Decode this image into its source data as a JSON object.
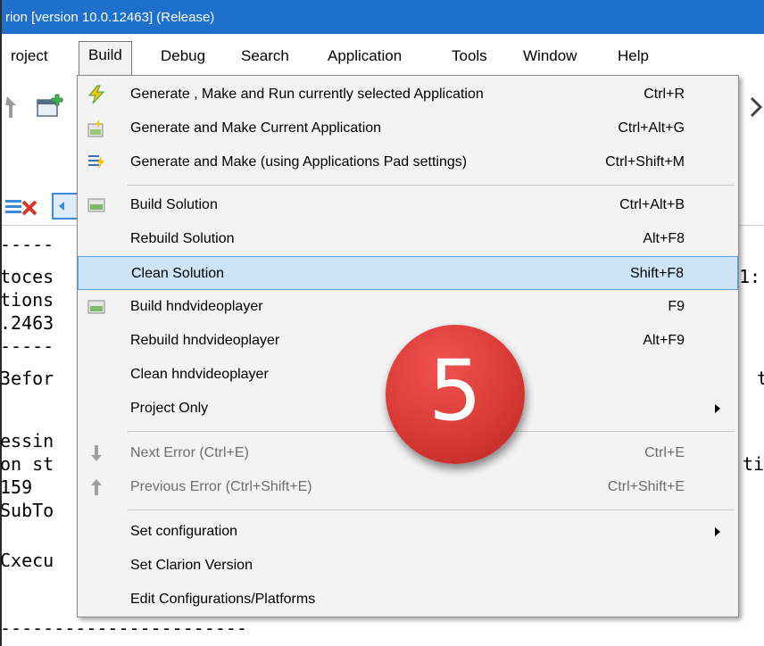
{
  "window": {
    "title": "rion [version 10.0.12463] (Release)"
  },
  "menubar": {
    "items": [
      "roject",
      "Build",
      "Debug",
      "Search",
      "Application",
      "Tools",
      "Window",
      "Help"
    ],
    "active": "Build"
  },
  "build_menu": {
    "items": [
      {
        "label": "Generate , Make and Run currently selected Application",
        "shortcut": "Ctrl+R",
        "icon": "lightning-run-icon"
      },
      {
        "label": "Generate and Make Current Application",
        "shortcut": "Ctrl+Alt+G",
        "icon": "generate-make-icon"
      },
      {
        "label": "Generate and Make (using Applications Pad settings)",
        "shortcut": "Ctrl+Shift+M",
        "icon": "generate-list-icon"
      },
      {
        "label": "Build Solution",
        "shortcut": "Ctrl+Alt+B",
        "icon": "build-solution-icon"
      },
      {
        "label": "Rebuild Solution",
        "shortcut": "Alt+F8"
      },
      {
        "label": "Clean Solution",
        "shortcut": "Shift+F8",
        "highlighted": true
      },
      {
        "label": "Build hndvideoplayer",
        "shortcut": "F9",
        "icon": "build-project-icon"
      },
      {
        "label": "Rebuild hndvideoplayer",
        "shortcut": "Alt+F9"
      },
      {
        "label": "Clean hndvideoplayer",
        "shortcut": ""
      },
      {
        "label": "Project Only",
        "shortcut": "",
        "submenu": true
      },
      {
        "label": "Next Error (Ctrl+E)",
        "shortcut": "Ctrl+E",
        "disabled": true,
        "icon": "arrow-down-icon"
      },
      {
        "label": "Previous Error (Ctrl+Shift+E)",
        "shortcut": "Ctrl+Shift+E",
        "disabled": true,
        "icon": "arrow-up-icon"
      },
      {
        "label": "Set configuration",
        "shortcut": "",
        "submenu": true
      },
      {
        "label": "Set Clarion Version",
        "shortcut": ""
      },
      {
        "label": "Edit Configurations/Platforms",
        "shortcut": ""
      }
    ]
  },
  "console": {
    "left_lines": [
      "-----",
      "toces",
      "tions",
      ".2463",
      "-----",
      "3efor",
      "",
      "essin",
      "on st",
      "159",
      "SubTo",
      "",
      "Cxecu",
      "",
      "",
      "-----------------------"
    ],
    "right_lines": [
      "1:",
      "t",
      "ti"
    ]
  },
  "callout": {
    "number": "5"
  },
  "colors": {
    "titlebar": "#1f6fcc",
    "highlight": "#cde4f7",
    "badge": "#d93a36"
  }
}
